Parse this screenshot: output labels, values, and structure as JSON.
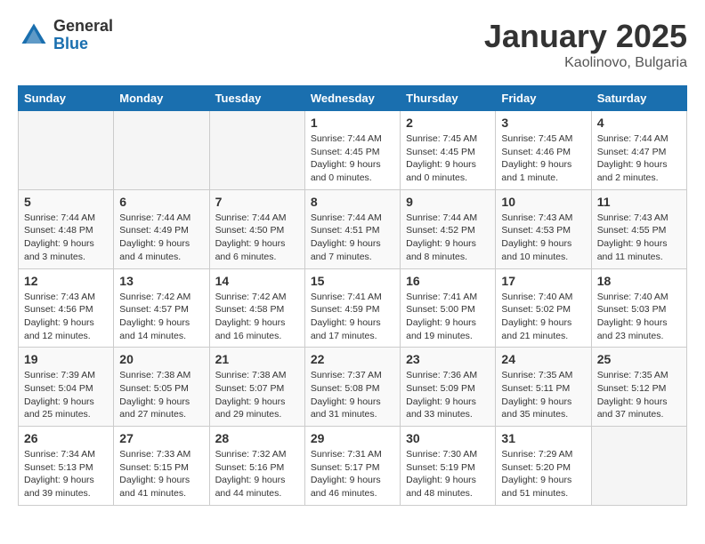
{
  "logo": {
    "general": "General",
    "blue": "Blue"
  },
  "title": "January 2025",
  "location": "Kaolinovo, Bulgaria",
  "weekdays": [
    "Sunday",
    "Monday",
    "Tuesday",
    "Wednesday",
    "Thursday",
    "Friday",
    "Saturday"
  ],
  "weeks": [
    [
      {
        "day": "",
        "info": ""
      },
      {
        "day": "",
        "info": ""
      },
      {
        "day": "",
        "info": ""
      },
      {
        "day": "1",
        "info": "Sunrise: 7:44 AM\nSunset: 4:45 PM\nDaylight: 9 hours\nand 0 minutes."
      },
      {
        "day": "2",
        "info": "Sunrise: 7:45 AM\nSunset: 4:45 PM\nDaylight: 9 hours\nand 0 minutes."
      },
      {
        "day": "3",
        "info": "Sunrise: 7:45 AM\nSunset: 4:46 PM\nDaylight: 9 hours\nand 1 minute."
      },
      {
        "day": "4",
        "info": "Sunrise: 7:44 AM\nSunset: 4:47 PM\nDaylight: 9 hours\nand 2 minutes."
      }
    ],
    [
      {
        "day": "5",
        "info": "Sunrise: 7:44 AM\nSunset: 4:48 PM\nDaylight: 9 hours\nand 3 minutes."
      },
      {
        "day": "6",
        "info": "Sunrise: 7:44 AM\nSunset: 4:49 PM\nDaylight: 9 hours\nand 4 minutes."
      },
      {
        "day": "7",
        "info": "Sunrise: 7:44 AM\nSunset: 4:50 PM\nDaylight: 9 hours\nand 6 minutes."
      },
      {
        "day": "8",
        "info": "Sunrise: 7:44 AM\nSunset: 4:51 PM\nDaylight: 9 hours\nand 7 minutes."
      },
      {
        "day": "9",
        "info": "Sunrise: 7:44 AM\nSunset: 4:52 PM\nDaylight: 9 hours\nand 8 minutes."
      },
      {
        "day": "10",
        "info": "Sunrise: 7:43 AM\nSunset: 4:53 PM\nDaylight: 9 hours\nand 10 minutes."
      },
      {
        "day": "11",
        "info": "Sunrise: 7:43 AM\nSunset: 4:55 PM\nDaylight: 9 hours\nand 11 minutes."
      }
    ],
    [
      {
        "day": "12",
        "info": "Sunrise: 7:43 AM\nSunset: 4:56 PM\nDaylight: 9 hours\nand 12 minutes."
      },
      {
        "day": "13",
        "info": "Sunrise: 7:42 AM\nSunset: 4:57 PM\nDaylight: 9 hours\nand 14 minutes."
      },
      {
        "day": "14",
        "info": "Sunrise: 7:42 AM\nSunset: 4:58 PM\nDaylight: 9 hours\nand 16 minutes."
      },
      {
        "day": "15",
        "info": "Sunrise: 7:41 AM\nSunset: 4:59 PM\nDaylight: 9 hours\nand 17 minutes."
      },
      {
        "day": "16",
        "info": "Sunrise: 7:41 AM\nSunset: 5:00 PM\nDaylight: 9 hours\nand 19 minutes."
      },
      {
        "day": "17",
        "info": "Sunrise: 7:40 AM\nSunset: 5:02 PM\nDaylight: 9 hours\nand 21 minutes."
      },
      {
        "day": "18",
        "info": "Sunrise: 7:40 AM\nSunset: 5:03 PM\nDaylight: 9 hours\nand 23 minutes."
      }
    ],
    [
      {
        "day": "19",
        "info": "Sunrise: 7:39 AM\nSunset: 5:04 PM\nDaylight: 9 hours\nand 25 minutes."
      },
      {
        "day": "20",
        "info": "Sunrise: 7:38 AM\nSunset: 5:05 PM\nDaylight: 9 hours\nand 27 minutes."
      },
      {
        "day": "21",
        "info": "Sunrise: 7:38 AM\nSunset: 5:07 PM\nDaylight: 9 hours\nand 29 minutes."
      },
      {
        "day": "22",
        "info": "Sunrise: 7:37 AM\nSunset: 5:08 PM\nDaylight: 9 hours\nand 31 minutes."
      },
      {
        "day": "23",
        "info": "Sunrise: 7:36 AM\nSunset: 5:09 PM\nDaylight: 9 hours\nand 33 minutes."
      },
      {
        "day": "24",
        "info": "Sunrise: 7:35 AM\nSunset: 5:11 PM\nDaylight: 9 hours\nand 35 minutes."
      },
      {
        "day": "25",
        "info": "Sunrise: 7:35 AM\nSunset: 5:12 PM\nDaylight: 9 hours\nand 37 minutes."
      }
    ],
    [
      {
        "day": "26",
        "info": "Sunrise: 7:34 AM\nSunset: 5:13 PM\nDaylight: 9 hours\nand 39 minutes."
      },
      {
        "day": "27",
        "info": "Sunrise: 7:33 AM\nSunset: 5:15 PM\nDaylight: 9 hours\nand 41 minutes."
      },
      {
        "day": "28",
        "info": "Sunrise: 7:32 AM\nSunset: 5:16 PM\nDaylight: 9 hours\nand 44 minutes."
      },
      {
        "day": "29",
        "info": "Sunrise: 7:31 AM\nSunset: 5:17 PM\nDaylight: 9 hours\nand 46 minutes."
      },
      {
        "day": "30",
        "info": "Sunrise: 7:30 AM\nSunset: 5:19 PM\nDaylight: 9 hours\nand 48 minutes."
      },
      {
        "day": "31",
        "info": "Sunrise: 7:29 AM\nSunset: 5:20 PM\nDaylight: 9 hours\nand 51 minutes."
      },
      {
        "day": "",
        "info": ""
      }
    ]
  ]
}
